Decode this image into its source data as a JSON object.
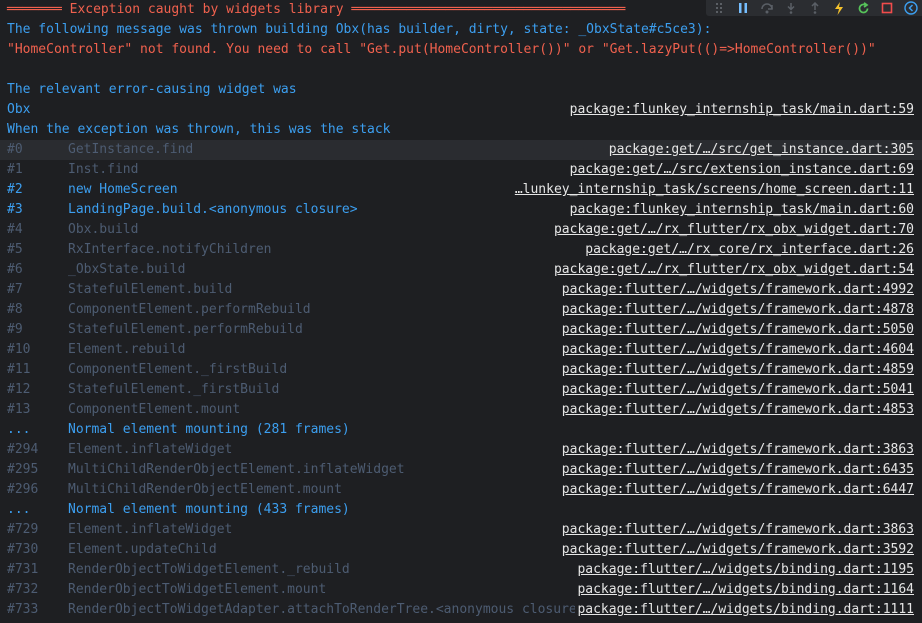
{
  "colors": {
    "background": "#1e1f22",
    "error_red": "#f0614e",
    "info_blue": "#3c9ff0",
    "dim_frame": "#4d5c72",
    "link": "#e6e6e6"
  },
  "toolbar": {
    "icons": [
      "drag-handle-icon",
      "pause-icon",
      "step-over-icon",
      "step-into-icon",
      "step-out-icon",
      "hot-reload-icon",
      "hot-restart-icon",
      "stop-icon",
      "devtools-icon"
    ]
  },
  "header": {
    "banner": "═══════ Exception caught by widgets library ═══════════════════════════════════",
    "message_line1": "The following message was thrown building Obx(has builder, dirty, state: _ObxState#c5ce3):",
    "message_line2": "\"HomeController\" not found. You need to call \"Get.put(HomeController())\" or \"Get.lazyPut(()=>HomeController())\"",
    "relevant_label": "The relevant error-causing widget was",
    "widget_name": "Obx",
    "widget_link": "package:flunkey_internship_task/main.dart:59",
    "stack_label": "When the exception was thrown, this was the stack"
  },
  "frames": [
    {
      "idx": "#0",
      "fn": "GetInstance.find",
      "link": "package:get/…/src/get_instance.dart:305",
      "style": "dim",
      "hl": true
    },
    {
      "idx": "#1",
      "fn": "Inst.find",
      "link": "package:get/…/src/extension_instance.dart:69",
      "style": "dim"
    },
    {
      "idx": "#2",
      "fn": "new HomeScreen",
      "link": "…lunkey_internship_task/screens/home_screen.dart:11",
      "style": "bright"
    },
    {
      "idx": "#3",
      "fn": "LandingPage.build.<anonymous closure>",
      "link": "package:flunkey_internship_task/main.dart:60",
      "style": "bright"
    },
    {
      "idx": "#4",
      "fn": "Obx.build",
      "link": "package:get/…/rx_flutter/rx_obx_widget.dart:70",
      "style": "dim"
    },
    {
      "idx": "#5",
      "fn": "RxInterface.notifyChildren",
      "link": "package:get/…/rx_core/rx_interface.dart:26",
      "style": "dim"
    },
    {
      "idx": "#6",
      "fn": "_ObxState.build",
      "link": "package:get/…/rx_flutter/rx_obx_widget.dart:54",
      "style": "dim"
    },
    {
      "idx": "#7",
      "fn": "StatefulElement.build",
      "link": "package:flutter/…/widgets/framework.dart:4992",
      "style": "dim"
    },
    {
      "idx": "#8",
      "fn": "ComponentElement.performRebuild",
      "link": "package:flutter/…/widgets/framework.dart:4878",
      "style": "dim"
    },
    {
      "idx": "#9",
      "fn": "StatefulElement.performRebuild",
      "link": "package:flutter/…/widgets/framework.dart:5050",
      "style": "dim"
    },
    {
      "idx": "#10",
      "fn": "Element.rebuild",
      "link": "package:flutter/…/widgets/framework.dart:4604",
      "style": "dim"
    },
    {
      "idx": "#11",
      "fn": "ComponentElement._firstBuild",
      "link": "package:flutter/…/widgets/framework.dart:4859",
      "style": "dim"
    },
    {
      "idx": "#12",
      "fn": "StatefulElement._firstBuild",
      "link": "package:flutter/…/widgets/framework.dart:5041",
      "style": "dim"
    },
    {
      "idx": "#13",
      "fn": "ComponentElement.mount",
      "link": "package:flutter/…/widgets/framework.dart:4853",
      "style": "dim"
    },
    {
      "idx": "...",
      "fn": "Normal element mounting (281 frames)",
      "link": "",
      "style": "bright",
      "collapsed": true
    },
    {
      "idx": "#294",
      "fn": "Element.inflateWidget",
      "link": "package:flutter/…/widgets/framework.dart:3863",
      "style": "dim"
    },
    {
      "idx": "#295",
      "fn": "MultiChildRenderObjectElement.inflateWidget",
      "link": "package:flutter/…/widgets/framework.dart:6435",
      "style": "dim"
    },
    {
      "idx": "#296",
      "fn": "MultiChildRenderObjectElement.mount",
      "link": "package:flutter/…/widgets/framework.dart:6447",
      "style": "dim"
    },
    {
      "idx": "...",
      "fn": "Normal element mounting (433 frames)",
      "link": "",
      "style": "bright",
      "collapsed": true
    },
    {
      "idx": "#729",
      "fn": "Element.inflateWidget",
      "link": "package:flutter/…/widgets/framework.dart:3863",
      "style": "dim"
    },
    {
      "idx": "#730",
      "fn": "Element.updateChild",
      "link": "package:flutter/…/widgets/framework.dart:3592",
      "style": "dim"
    },
    {
      "idx": "#731",
      "fn": "RenderObjectToWidgetElement._rebuild",
      "link": "package:flutter/…/widgets/binding.dart:1195",
      "style": "dim"
    },
    {
      "idx": "#732",
      "fn": "RenderObjectToWidgetElement.mount",
      "link": "package:flutter/…/widgets/binding.dart:1164",
      "style": "dim"
    },
    {
      "idx": "#733",
      "fn": "RenderObjectToWidgetAdapter.attachToRenderTree.<anonymous closure>",
      "link": "package:flutter/…/widgets/binding.dart:1111",
      "style": "dim"
    }
  ]
}
